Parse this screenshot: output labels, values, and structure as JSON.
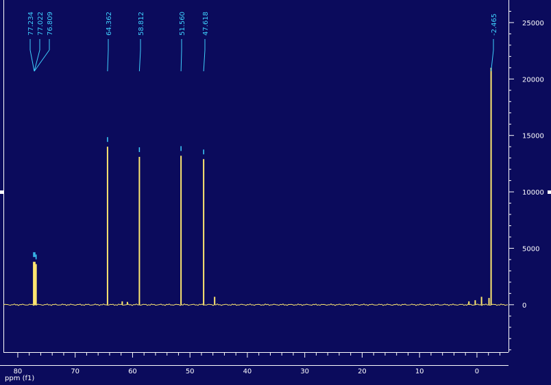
{
  "chart_data": {
    "type": "line",
    "title": "",
    "xlabel": "ppm (f1)",
    "ylabel": "",
    "xlim": [
      82.5,
      -5.5
    ],
    "ylim": [
      -4200,
      27000
    ],
    "x_ticks": [
      "80",
      "70",
      "60",
      "50",
      "40",
      "30",
      "20",
      "10",
      "0"
    ],
    "y_ticks": [
      "25000",
      "20000",
      "15000",
      "10000",
      "5000",
      "0"
    ],
    "peak_labels": [
      "77.234",
      "77.022",
      "76.809",
      "64.362",
      "58.812",
      "51.560",
      "47.618",
      "-2.465"
    ],
    "series": [
      {
        "peaks": [
          {
            "x": 77.234,
            "y": 3800
          },
          {
            "x": 77.022,
            "y": 3800
          },
          {
            "x": 76.809,
            "y": 3600
          },
          {
            "x": 64.362,
            "y": 14000
          },
          {
            "x": 58.812,
            "y": 13100
          },
          {
            "x": 51.56,
            "y": 13200
          },
          {
            "x": 47.618,
            "y": 12900
          },
          {
            "x": 45.7,
            "y": 700
          },
          {
            "x": 61.8,
            "y": 300
          },
          {
            "x": 60.9,
            "y": 250
          },
          {
            "x": 1.4,
            "y": 300
          },
          {
            "x": 0.3,
            "y": 400
          },
          {
            "x": -0.8,
            "y": 700
          },
          {
            "x": -2.1,
            "y": 600
          },
          {
            "x": -2.465,
            "y": 21000
          }
        ]
      }
    ],
    "grid": false,
    "colors": {
      "background": "#0b0b5c",
      "trace": "#ffe870",
      "peak_label": "#3fd2ff",
      "axis": "#ffffff"
    }
  }
}
